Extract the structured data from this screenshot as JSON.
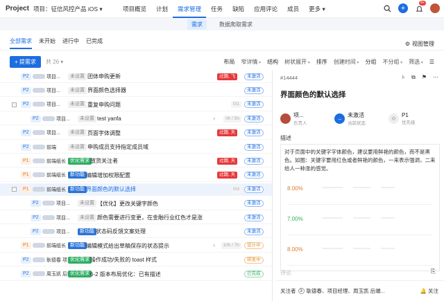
{
  "app": {
    "brand": "Project",
    "project_label": "项目：征信风控产品 iOS ▾"
  },
  "nav": [
    "项目概览",
    "计划",
    "需求管理",
    "任务",
    "缺陷",
    "应用评论",
    "成员",
    "更多 ▾"
  ],
  "nav_active": 2,
  "topicons": {
    "notify_count": "9+"
  },
  "subtabs": [
    "需求",
    "数据爬取需求"
  ],
  "view_tabs": [
    "全部需求",
    "未开始",
    "进行中",
    "已完成"
  ],
  "view_manage": "视图管理",
  "toolbar": {
    "add": "+ 提需求",
    "count": "共 26 ▾",
    "layout_label": "布局",
    "layout_value": "窄详情",
    "structure_label": "结构",
    "structure_value": "树状展开",
    "sort_label": "排序",
    "sort_value": "创建时间",
    "group_label": "分组",
    "group_value": "不分组",
    "filter": "筛选"
  },
  "rows": [
    {
      "prio": "P2",
      "owner": "项目...",
      "tag": "未设置",
      "tagc": "gray",
      "title": "团体申购更新",
      "overdue": "过期, 飞",
      "prog": "",
      "stat": "未激活",
      "statc": "blue",
      "exp": "",
      "indent": 0,
      "tagw": 24
    },
    {
      "prio": "P2",
      "owner": "项目...",
      "tag": "未设置",
      "tagc": "gray",
      "title": "界面颜色选择器",
      "overdue": "",
      "prog": "",
      "stat": "未激活",
      "statc": "blue",
      "exp": "",
      "indent": 0,
      "tagw": 24
    },
    {
      "prio": "P2",
      "owner": "项目...",
      "tag": "未设置",
      "tagc": "gray",
      "title": "重复申购问题",
      "overdue": "",
      "prog": "0/1",
      "stat": "未激活",
      "statc": "blue",
      "exp": "-",
      "indent": 0,
      "tagw": 24
    },
    {
      "prio": "P2",
      "owner": "项目...",
      "tag": "未设置",
      "tagc": "gray",
      "title": "test yanfa",
      "overdue": "",
      "prog": "0h / 5h",
      "stat": "未激活",
      "statc": "blue",
      "exp": "",
      "indent": 1,
      "tagw": 24
    },
    {
      "prio": "P2",
      "owner": "项目...",
      "tag": "未设置",
      "tagc": "gray",
      "title": "页面字体调整",
      "overdue": "过期, 天",
      "prog": "",
      "stat": "未激活",
      "statc": "blue",
      "exp": "",
      "indent": 0,
      "tagw": 24
    },
    {
      "prio": "P2",
      "owner": "前端",
      "tag": "未设置",
      "tagc": "gray",
      "title": "申购成员支持指定成员域",
      "overdue": "",
      "prog": "",
      "stat": "未激活",
      "statc": "blue",
      "exp": "",
      "indent": 0,
      "tagw": 24
    },
    {
      "prio": "P1",
      "owner": "前端组长",
      "tag": "优化需求",
      "tagc": "green",
      "title": "放货关注者",
      "overdue": "过期, 天",
      "prog": "",
      "stat": "未激活",
      "statc": "blue",
      "exp": "",
      "indent": 0,
      "tagw": 28
    },
    {
      "prio": "P1",
      "owner": "前端组长",
      "tag": "新功能",
      "tagc": "blue",
      "title": "编辑增加权限配置",
      "overdue": "过期, 天",
      "prog": "",
      "stat": "未激活",
      "statc": "blue",
      "exp": "",
      "indent": 0,
      "tagw": 22
    },
    {
      "prio": "P1",
      "owner": "前端组长",
      "tag": "新功能",
      "tagc": "blue",
      "title": "界面颜色的默认选择",
      "overdue": "",
      "prog": "0/3",
      "stat": "未激活",
      "statc": "blue",
      "exp": "-",
      "indent": 0,
      "tagw": 22,
      "selected": true
    },
    {
      "prio": "P2",
      "owner": "项目...",
      "tag": "未设置",
      "tagc": "gray",
      "title": "【优化】更改关键字颜色",
      "overdue": "",
      "prog": "",
      "stat": "未激活",
      "statc": "blue",
      "exp": "",
      "indent": 1,
      "tagw": 24
    },
    {
      "prio": "P2",
      "owner": "项目...",
      "tag": "未设置",
      "tagc": "gray",
      "title": "颜色需要进行变更，在金融行业红色才是涨",
      "overdue": "",
      "prog": "",
      "stat": "未激活",
      "statc": "blue",
      "exp": "",
      "indent": 1,
      "tagw": 24
    },
    {
      "prio": "P2",
      "owner": "项目...",
      "tag": "新功能",
      "tagc": "blue",
      "title": "状态码反馈文案处理",
      "overdue": "",
      "prog": "",
      "stat": "未激活",
      "statc": "blue",
      "exp": "",
      "indent": 1,
      "tagw": 22
    },
    {
      "prio": "P1",
      "owner": "前端组长",
      "tag": "新功能",
      "tagc": "blue",
      "title": "编辑模式给出草稿保存的状态提示",
      "overdue": "",
      "prog": "10h / 7h",
      "stat": "设计中",
      "statc": "orange",
      "exp": "",
      "indent": 0,
      "tagw": 22
    },
    {
      "prio": "P2",
      "owner": "耿德春 项目...",
      "tag": "优化需求",
      "tagc": "green",
      "title": "操作成功/失败的 toast 样式",
      "overdue": "",
      "prog": "",
      "stat": "研发中",
      "statc": "orange",
      "exp": "",
      "indent": 0,
      "tagw": 28
    },
    {
      "prio": "P2",
      "owner": "周玉凯 后端...",
      "tag": "优化需求",
      "tagc": "green",
      "title": "6-2 版本布局优化：已有描述",
      "overdue": "",
      "prog": "",
      "stat": "已完成",
      "statc": "green",
      "exp": "",
      "indent": 0,
      "tagw": 28
    }
  ],
  "detail": {
    "id": "#14444",
    "title": "界面颜色的默认选择",
    "owner_name": "项...",
    "owner_label": "负责人",
    "status_value": "未激活",
    "status_label": "当前状态",
    "priority_value": "P1",
    "priority_label": "优先级",
    "desc_label": "描述",
    "desc_text": "对于页面中的关键字字体颜色，建议要用鲜艳的颜色，而不是黑色。如图：关键字要用红色或者鲜艳的颜色，一来表示强调，二来给人一种涨的感觉。",
    "mock_values": [
      "8.00%",
      "7.00%",
      "8.00%"
    ],
    "comment_placeholder": "评论",
    "follow_label": "关注者",
    "follow_count": "3",
    "followers": "耿德春、项目经理、周玉凯 后端...",
    "follow_btn": "关注"
  }
}
